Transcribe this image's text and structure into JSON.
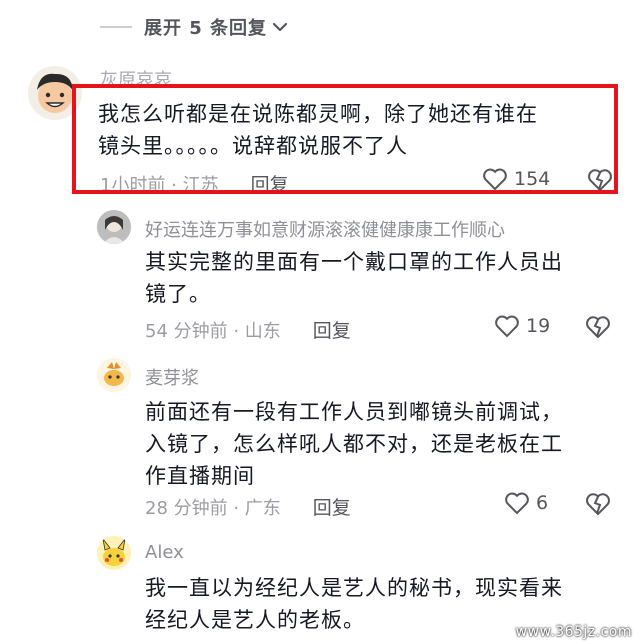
{
  "expand": {
    "label": "展开 5 条回复"
  },
  "comments": [
    {
      "user": "灰原哀哀",
      "text_lines": [
        "我怎么听都是在说陈都灵啊，除了她还有谁在",
        "镜头里。。。。。说辞都说服不了人"
      ],
      "meta": "1小时前 · 江苏",
      "reply": "回复",
      "likes": "154"
    },
    {
      "user": "好运连连万事如意财源滚滚健健康康工作顺心",
      "text_lines": [
        "其实完整的里面有一个戴口罩的工作人员出",
        "镜了。"
      ],
      "meta": "54 分钟前 · 山东",
      "reply": "回复",
      "likes": "19"
    },
    {
      "user": "麦芽浆",
      "text_lines": [
        "前面还有一段有工作人员到嘟镜头前调试，",
        "入镜了，怎么样吼人都不对，还是老板在工",
        "作直播期间"
      ],
      "meta": "28 分钟前 · 广东",
      "reply": "回复",
      "likes": "6"
    },
    {
      "user": "Alex",
      "text_lines": [
        "我一直以为经纪人是艺人的秘书，现实看来",
        "经纪人是艺人的老板。"
      ],
      "meta": "",
      "reply": "",
      "likes": ""
    }
  ],
  "watermark": "www.365jz.com",
  "colors": {
    "highlight": "#e3141b",
    "text": "#161823",
    "meta": "#9c9da3"
  },
  "icons": [
    "chevron-down-icon",
    "heart-icon",
    "dislike-heart-icon"
  ]
}
